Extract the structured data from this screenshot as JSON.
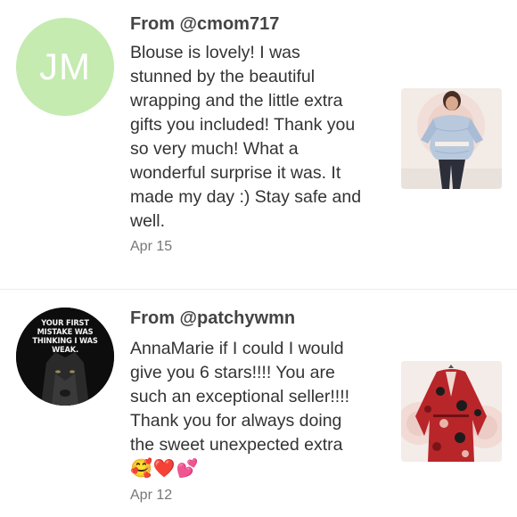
{
  "reviews": [
    {
      "avatar_initials": "JM",
      "from": "From @cmom717",
      "comment_lines": [
        "Blouse is lovely! I was",
        "stunned by the beautiful",
        "wrapping and the little extra",
        "gifts you included! Thank you",
        "so very much! What a",
        "wonderful surprise it was. It",
        "made my day :) Stay safe and",
        "well."
      ],
      "date": "Apr 15",
      "thumbnail": "blouse-photo"
    },
    {
      "avatar_text": "YOUR FIRST MISTAKE WAS THINKING I WAS WEAK.",
      "from": "From @patchywmn",
      "comment_lines": [
        "AnnaMarie if I could I would",
        "give you 6 stars!!!! You are",
        "such an exceptional seller!!!!",
        "Thank you for always doing",
        "the sweet unexpected extra",
        "🥰❤️💕"
      ],
      "date": "Apr 12",
      "thumbnail": "red-floral-dress-photo"
    }
  ],
  "colors": {
    "avatar_green": "#c5ebb0",
    "text": "#333333",
    "muted": "#777777",
    "divider": "#ececec"
  }
}
